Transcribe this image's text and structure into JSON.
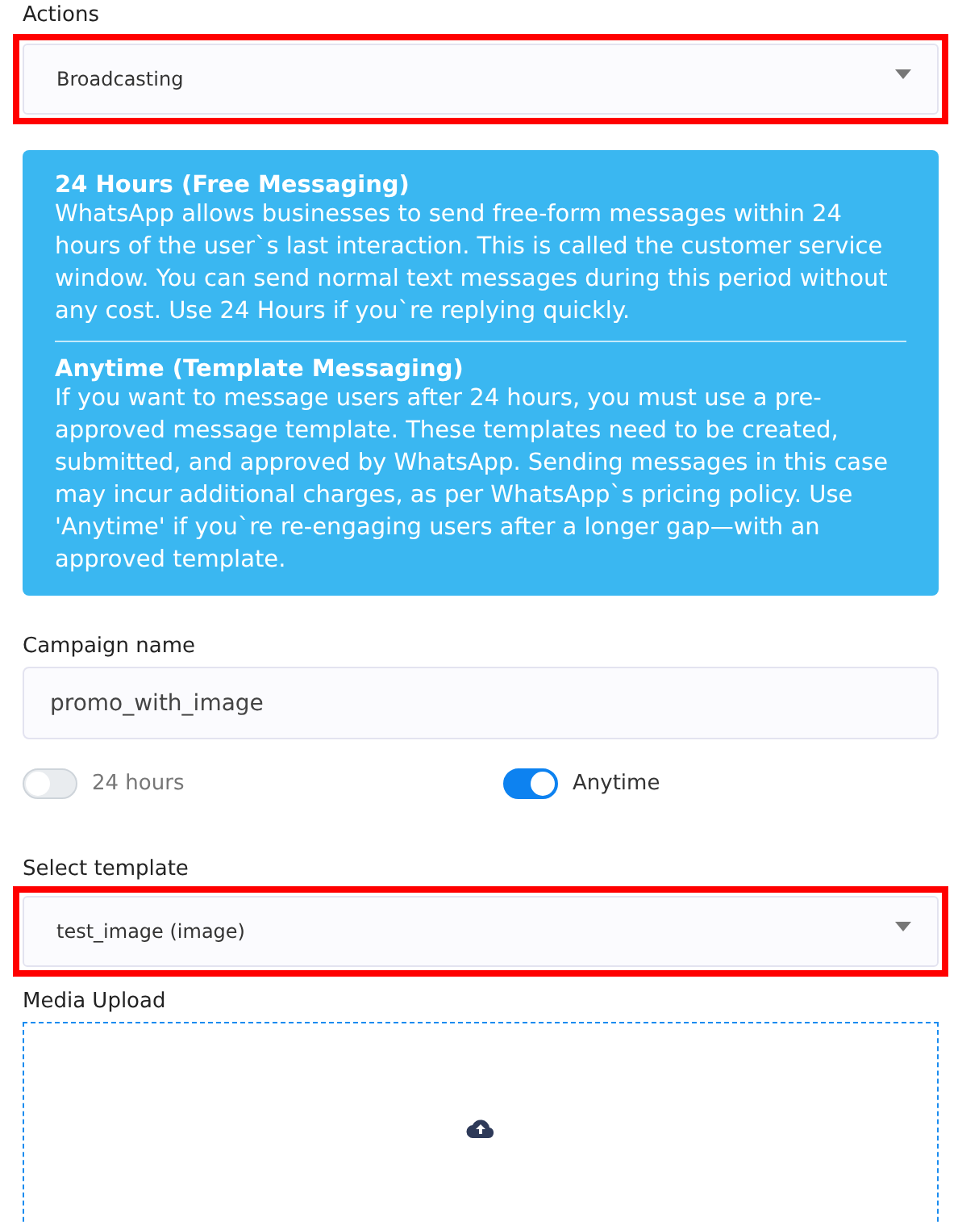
{
  "actions": {
    "label": "Actions",
    "value": "Broadcasting",
    "highlighted": true
  },
  "info": {
    "sections": [
      {
        "title": "24 Hours (Free Messaging)",
        "body": "WhatsApp allows businesses to send free-form messages within 24 hours of the user`s last interaction. This is called the customer service window. You can send normal text messages during this period without any cost. Use 24 Hours if you`re replying quickly."
      },
      {
        "title": "Anytime (Template Messaging)",
        "body": "If you want to message users after 24 hours, you must use a pre-approved message template. These templates need to be created, submitted, and approved by WhatsApp. Sending messages in this case may incur additional charges, as per WhatsApp`s pricing policy. Use 'Anytime' if you`re re-engaging users after a longer gap—with an approved template."
      }
    ]
  },
  "campaign_name": {
    "label": "Campaign name",
    "value": "promo_with_image"
  },
  "toggles": [
    {
      "label": "24 hours",
      "on": false
    },
    {
      "label": "Anytime",
      "on": true
    }
  ],
  "template": {
    "label": "Select template",
    "value": "test_image (image)",
    "highlighted": true
  },
  "media_upload": {
    "label": "Media Upload"
  }
}
